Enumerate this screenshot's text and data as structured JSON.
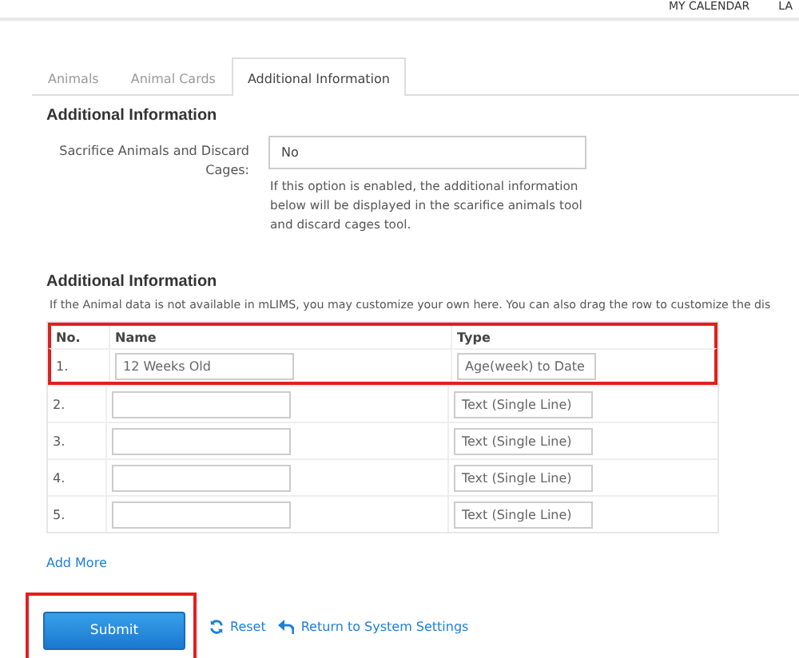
{
  "top_nav": [
    "MY CALENDAR",
    "LA"
  ],
  "tabs": [
    {
      "label": "Animals",
      "selected": false
    },
    {
      "label": "Animal Cards",
      "selected": false
    },
    {
      "label": "Additional Information",
      "selected": true
    }
  ],
  "settings": {
    "title": "Additional Information",
    "field_label": "Sacrifice Animals and Discard Cages:",
    "value": "No",
    "help": "If this option is enabled, the additional information below will be displayed in the scarifice animals tool and discard cages tool."
  },
  "custom_fields": {
    "title": "Additional Information",
    "description": "If the Animal data is not available in mLIMS, you may customize your own here. You can also drag the row to customize the dis",
    "table": {
      "columns": [
        "No.",
        "Name",
        "Type"
      ],
      "header_highlighted": true,
      "rows": [
        {
          "no": "1.",
          "name": "12 Weeks Old",
          "type": "Age(week) to Date",
          "highlighted": true
        },
        {
          "no": "2.",
          "name": "",
          "type": "Text (Single Line)",
          "highlighted": false
        },
        {
          "no": "3.",
          "name": "",
          "type": "Text (Single Line)",
          "highlighted": false
        },
        {
          "no": "4.",
          "name": "",
          "type": "Text (Single Line)",
          "highlighted": false
        },
        {
          "no": "5.",
          "name": "",
          "type": "Text (Single Line)",
          "highlighted": false
        }
      ]
    },
    "add_more": "Add More"
  },
  "actions": {
    "submit": "Submit",
    "submit_highlighted": true,
    "reset": "Reset",
    "return": "Return to System Settings"
  }
}
